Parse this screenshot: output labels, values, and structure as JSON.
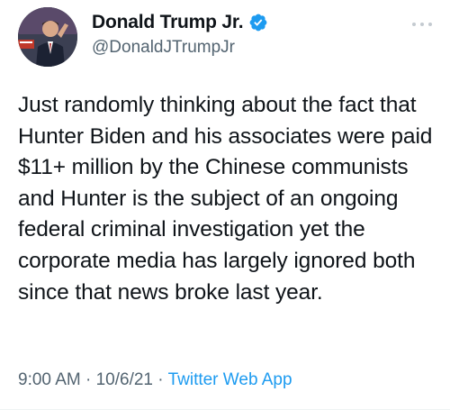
{
  "author": {
    "display_name": "Donald Trump Jr.",
    "handle": "@DonaldJTrumpJr",
    "verified": true
  },
  "tweet": {
    "text": "Just randomly thinking about the fact that Hunter Biden and his associates were paid $11+ million by the Chinese communists and Hunter is the subject of an ongoing federal criminal investigation yet the corporate media has largely ignored both since that news broke last year.",
    "time": "9:00 AM",
    "separator": "·",
    "date": "10/6/21",
    "source": "Twitter Web App"
  },
  "colors": {
    "text": "#0f1419",
    "secondary": "#536471",
    "accent": "#1d9bf0"
  },
  "icons": {
    "verified": "verified-badge-icon",
    "more": "more-options-icon"
  }
}
